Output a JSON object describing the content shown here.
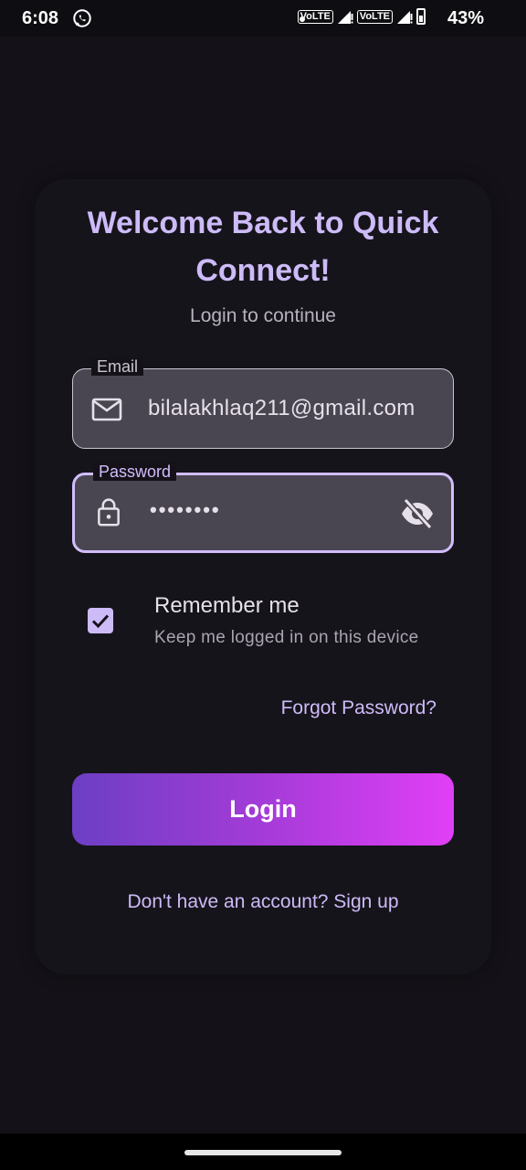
{
  "status_bar": {
    "time": "6:08",
    "network_1": "VoLTE",
    "network_2": "VoLTE",
    "battery": "43%",
    "icons": [
      "whatsapp-icon",
      "notification-dot-icon",
      "signal-icon",
      "signal-icon",
      "battery-icon"
    ]
  },
  "login": {
    "title": "Welcome Back to Quick Connect!",
    "subtitle": "Login to continue",
    "email": {
      "label": "Email",
      "value": "bilalakhlaq211@gmail.com",
      "icon": "mail-icon"
    },
    "password": {
      "label": "Password",
      "value": "••••••••",
      "icon": "lock-icon",
      "toggle_icon": "eye-off-icon"
    },
    "remember": {
      "checked": true,
      "title": "Remember me",
      "subtitle": "Keep me logged in on this device"
    },
    "forgot_password": "Forgot Password?",
    "login_button": "Login",
    "signup_prompt": "Don't have an account? Sign up"
  },
  "colors": {
    "background": "#141218",
    "accent": "#cdbbf8",
    "gradient_start": "#6c3fc4",
    "gradient_end": "#e13ff6"
  }
}
